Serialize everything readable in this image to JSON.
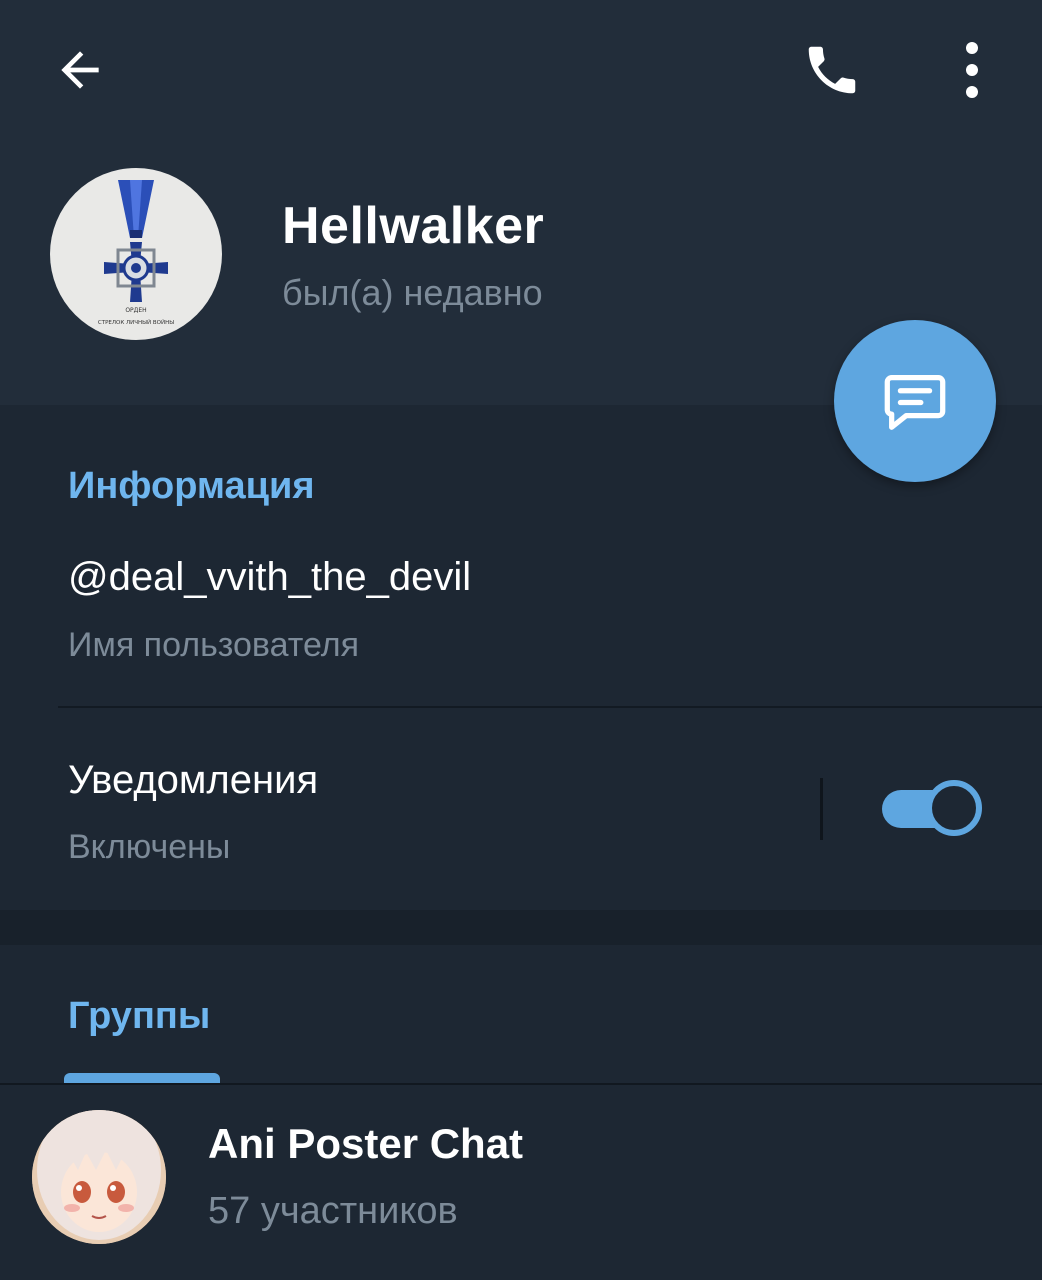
{
  "header": {
    "back_icon": "arrow-left-icon",
    "call_icon": "phone-icon",
    "more_icon": "more-vertical-icon"
  },
  "profile": {
    "name": "Hellwalker",
    "status": "был(а) недавно",
    "avatar_icon": "medal-cross-icon",
    "avatar_lettering": "ОРДЕН · СТРЕЛОК ЛИЧНЫЙ ВОЙНЫ"
  },
  "fab": {
    "icon": "message-icon"
  },
  "info": {
    "title": "Информация",
    "username": "@deal_vvith_the_devil",
    "username_label": "Имя пользователя",
    "notifications_title": "Уведомления",
    "notifications_status": "Включены",
    "notifications_enabled": true
  },
  "groups": {
    "title": "Группы",
    "items": [
      {
        "name": "Ani Poster Chat",
        "members": "57 участников",
        "avatar_icon": "anime-girl-avatar"
      }
    ]
  },
  "colors": {
    "accent": "#5ea6e0",
    "section_title": "#6fb6ef",
    "header_bg": "#222d3a",
    "body_bg": "#1d2733",
    "secondary_text": "#7d8b99"
  }
}
